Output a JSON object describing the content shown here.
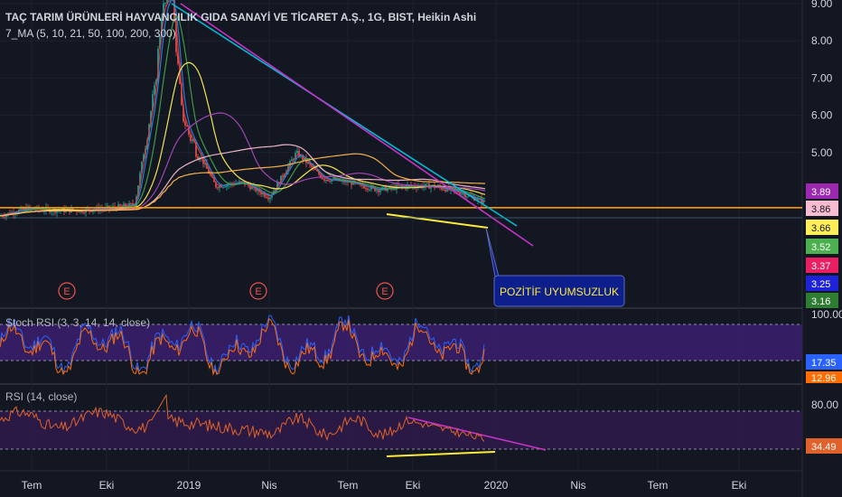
{
  "header": {
    "title": "TAÇ TARIM ÜRÜNLERİ HAYVANCILIK GIDA SANAYİ VE TİCARET A.Ş., 1G, BIST, Heikin Ashi",
    "indicator": "7_MA (5, 10, 21, 50, 100, 200, 300)"
  },
  "panes": {
    "stoch_title": "Stoch RSI (3, 3, 14, 14, close)",
    "rsi_title": "RSI (14, close)"
  },
  "annotation": {
    "label": "POZİTİF UYUMSUZLUK"
  },
  "events": [
    "E",
    "E",
    "E"
  ],
  "colors": {
    "background": "#131722",
    "up": "#26a69a",
    "down": "#ef5350",
    "trend_cyan": "#00bcd4",
    "trend_magenta": "#c733c7",
    "support_orange": "#ff9800",
    "divergence_yellow": "#ffeb3b",
    "stoch_band": "#3b1f6e",
    "rsi_band": "#2e1a4a",
    "rsi_line": "#e0622a",
    "annotation_bg": "#0d1f8c"
  },
  "chart_data": [
    {
      "type": "candlestick",
      "title": "TAÇ TARIM ÜRÜNLERİ HAYVANCILIK GIDA SANAYİ VE TİCARET A.Ş., 1G, BIST, Heikin Ashi",
      "x_ticks": [
        "Tem",
        "Eki",
        "2019",
        "Nis",
        "Tem",
        "Eki",
        "2020",
        "Nis",
        "Tem",
        "Eki"
      ],
      "y_ticks": [
        9.0,
        8.0,
        7.0,
        6.0,
        5.0
      ],
      "ylim": [
        2.7,
        9.0
      ],
      "price_labels": [
        {
          "value": "3.89",
          "color": "#9c27b0"
        },
        {
          "value": "3.86",
          "color": "#f8bbd0"
        },
        {
          "value": "3.66",
          "color": "#ffee58"
        },
        {
          "value": "3.52",
          "color": "#4caf50"
        },
        {
          "value": "3.37",
          "color": "#e91e63"
        },
        {
          "value": "3.25",
          "color": "#1e22d8"
        },
        {
          "value": "3.16",
          "color": "#2e7d32"
        }
      ],
      "close_series_approx": [
        {
          "x": "2018-06-01",
          "y": 3.3
        },
        {
          "x": "2018-07-01",
          "y": 3.5
        },
        {
          "x": "2018-08-01",
          "y": 3.45
        },
        {
          "x": "2018-09-01",
          "y": 3.45
        },
        {
          "x": "2018-10-01",
          "y": 3.5
        },
        {
          "x": "2018-11-01",
          "y": 3.6
        },
        {
          "x": "2018-12-01",
          "y": 7.8
        },
        {
          "x": "2019-01-01",
          "y": 5.5
        },
        {
          "x": "2019-02-01",
          "y": 4.1
        },
        {
          "x": "2019-03-01",
          "y": 4.2
        },
        {
          "x": "2019-04-01",
          "y": 3.8
        },
        {
          "x": "2019-05-01",
          "y": 5.0
        },
        {
          "x": "2019-06-01",
          "y": 4.3
        },
        {
          "x": "2019-07-01",
          "y": 4.2
        },
        {
          "x": "2019-08-01",
          "y": 4.0
        },
        {
          "x": "2019-09-01",
          "y": 4.1
        },
        {
          "x": "2019-10-01",
          "y": 4.1
        },
        {
          "x": "2019-11-01",
          "y": 3.95
        },
        {
          "x": "2019-12-15",
          "y": 3.66
        }
      ],
      "moving_averages_last": [
        "3.89",
        "3.86",
        "3.66",
        "3.52",
        "3.37",
        "3.25",
        "3.16"
      ],
      "horizontal_support": 3.52
    },
    {
      "type": "line",
      "title": "Stoch RSI (3, 3, 14, 14, close)",
      "y_ticks": [
        "100.00"
      ],
      "last_values": [
        "17.35",
        "12.96"
      ],
      "band": [
        20,
        80
      ]
    },
    {
      "type": "line",
      "title": "RSI (14, close)",
      "y_ticks": [
        "80.00"
      ],
      "last_value": "34.49",
      "band": [
        30,
        70
      ]
    }
  ]
}
